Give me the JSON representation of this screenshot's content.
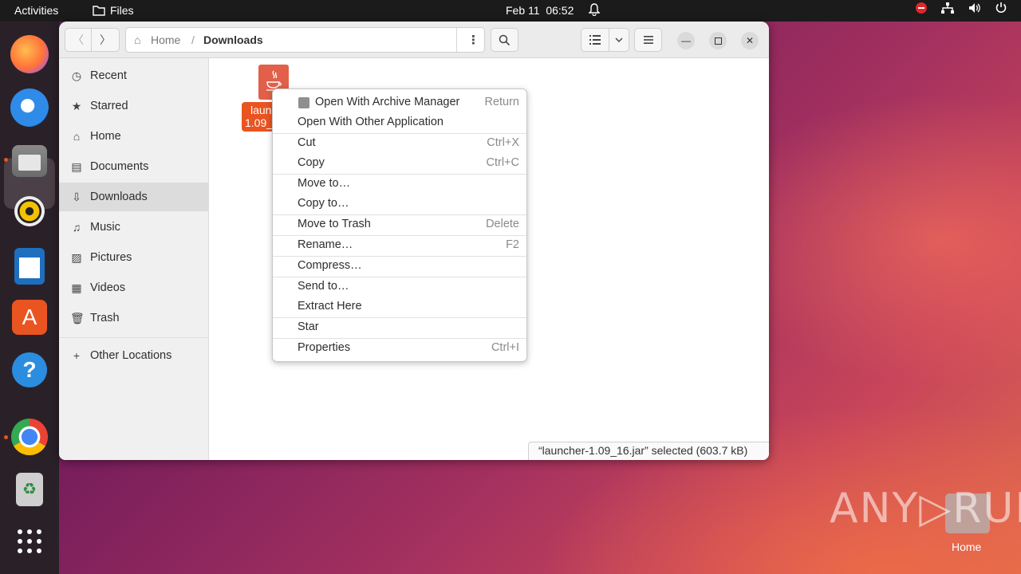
{
  "topbar": {
    "activities": "Activities",
    "app_name": "Files",
    "date": "Feb 11",
    "time": "06:52"
  },
  "window": {
    "path": {
      "home": "Home",
      "separator": "/",
      "current": "Downloads"
    }
  },
  "sidebar": {
    "items": [
      {
        "label": "Recent",
        "icon": "clock-icon",
        "glyph": "◷"
      },
      {
        "label": "Starred",
        "icon": "star-icon",
        "glyph": "★"
      },
      {
        "label": "Home",
        "icon": "home-icon",
        "glyph": "⌂"
      },
      {
        "label": "Documents",
        "icon": "document-icon",
        "glyph": "▤"
      },
      {
        "label": "Downloads",
        "icon": "download-icon",
        "glyph": "⇩"
      },
      {
        "label": "Music",
        "icon": "music-icon",
        "glyph": "♫"
      },
      {
        "label": "Pictures",
        "icon": "picture-icon",
        "glyph": "▨"
      },
      {
        "label": "Videos",
        "icon": "video-icon",
        "glyph": "▦"
      },
      {
        "label": "Trash",
        "icon": "trash-icon",
        "glyph": "🗑"
      }
    ],
    "other_locations": "Other Locations"
  },
  "file": {
    "label_line1": "laun",
    "label_line2": "1.09_"
  },
  "context_menu": {
    "items": [
      {
        "label": "Open With Archive Manager",
        "accel": "Return"
      },
      {
        "label": "Open With Other Application",
        "accel": ""
      },
      {
        "label": "Cut",
        "accel": "Ctrl+X"
      },
      {
        "label": "Copy",
        "accel": "Ctrl+C"
      },
      {
        "label": "Move to…",
        "accel": ""
      },
      {
        "label": "Copy to…",
        "accel": ""
      },
      {
        "label": "Move to Trash",
        "accel": "Delete"
      },
      {
        "label": "Rename…",
        "accel": "F2"
      },
      {
        "label": "Compress…",
        "accel": ""
      },
      {
        "label": "Send to…",
        "accel": ""
      },
      {
        "label": "Extract Here",
        "accel": ""
      },
      {
        "label": "Star",
        "accel": ""
      },
      {
        "label": "Properties",
        "accel": "Ctrl+I"
      }
    ]
  },
  "status": {
    "selected": "“launcher-1.09_16.jar” selected  (603.7 kB)"
  },
  "desktop": {
    "watermark": "ANY▷RUN",
    "home_label": "Home"
  },
  "colors": {
    "accent": "#e95420",
    "topbar": "#1b1b1b",
    "dock": "#2a2128"
  }
}
